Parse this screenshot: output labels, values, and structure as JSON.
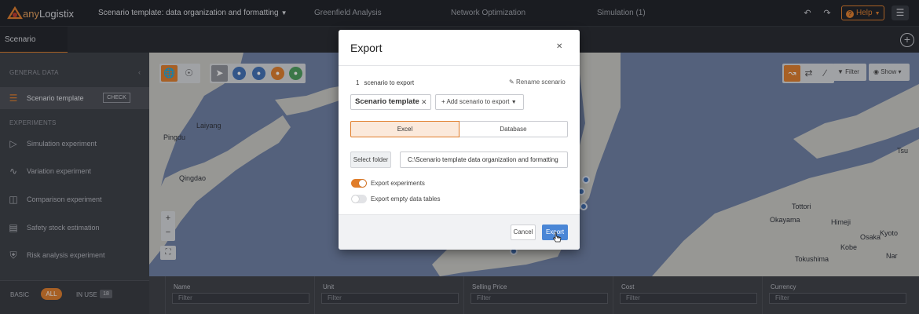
{
  "app": {
    "logo_prefix": "any",
    "logo_name": "Logistix",
    "project_title": "Scenario template: data organization and formatting",
    "nav": [
      "Greenfield Analysis",
      "Network Optimization",
      "Simulation (1)"
    ],
    "help_label": "Help"
  },
  "tabs": [
    {
      "label": "Scenario template"
    }
  ],
  "sidebar": {
    "general_header": "GENERAL DATA",
    "scenario_item": {
      "label": "Scenario template",
      "check_label": "CHECK",
      "icon": "database-icon"
    },
    "experiments_header": "EXPERIMENTS",
    "experiments": [
      {
        "label": "Simulation experiment",
        "icon": "play-circle-icon"
      },
      {
        "label": "Variation experiment",
        "icon": "variation-icon"
      },
      {
        "label": "Comparison experiment",
        "icon": "compare-icon"
      },
      {
        "label": "Safety stock estimation",
        "icon": "chart-icon"
      },
      {
        "label": "Risk analysis experiment",
        "icon": "shield-icon"
      }
    ],
    "footer": {
      "basic": "BASIC",
      "all": "ALL",
      "in_use": "IN USE",
      "in_use_count": "18"
    }
  },
  "map": {
    "labels": [
      "Laiyang",
      "Pingdu",
      "Qingdao",
      "Tottori",
      "Okayama",
      "Himeji",
      "Kobe",
      "Osaka",
      "Kyoto",
      "Nar",
      "Tsu",
      "Tokushima"
    ],
    "toolbar_right": {
      "filter": "Filter",
      "show": "Show"
    },
    "zoom_in": "+",
    "zoom_out": "−"
  },
  "table": {
    "columns": [
      {
        "name": "Name",
        "filter": "Filter"
      },
      {
        "name": "Unit",
        "filter": "Filter"
      },
      {
        "name": "Selling Price",
        "filter": "Filter"
      },
      {
        "name": "Cost",
        "filter": "Filter"
      },
      {
        "name": "Currency",
        "filter": "Filter"
      }
    ]
  },
  "modal": {
    "title": "Export",
    "count": "1",
    "count_text": "scenario to export",
    "rename_label": "Rename scenario",
    "scenario_chip": "Scenario template",
    "add_scenario": "Add scenario to export",
    "format_options": [
      "Excel",
      "Database"
    ],
    "selected_format": "Excel",
    "select_folder": "Select folder",
    "folder_path": "C:\\Scenario template data organization and formatting",
    "toggles": [
      {
        "label": "Export experiments",
        "on": true
      },
      {
        "label": "Export empty data tables",
        "on": false
      }
    ],
    "cancel_label": "Cancel",
    "export_label": "Export"
  },
  "colors": {
    "accent": "#e07d2a",
    "primary": "#4a86d6",
    "map_water": "#6d7ea3"
  }
}
